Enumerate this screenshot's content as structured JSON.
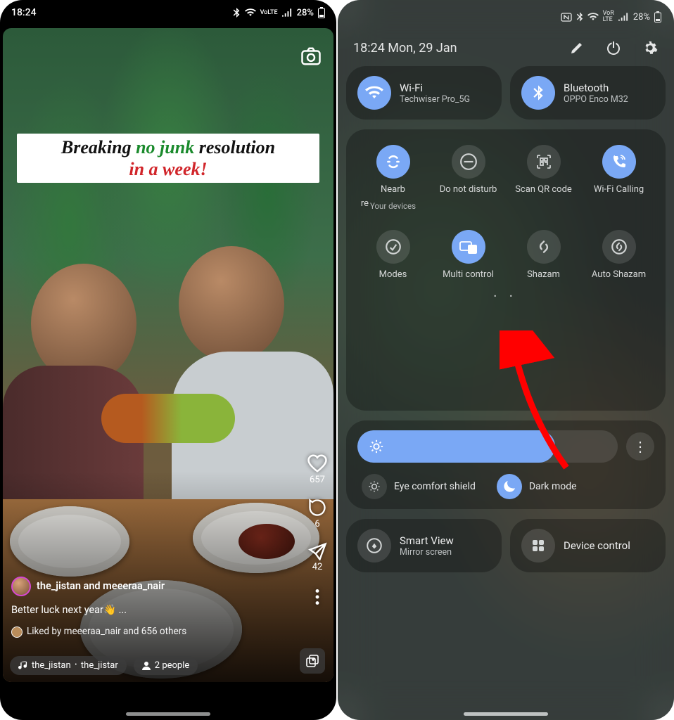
{
  "left_status": {
    "time": "18:24",
    "battery": "28%",
    "net": "VoLTE"
  },
  "story": {
    "banner_a": "Breaking ",
    "banner_b": "no junk",
    "banner_c": " resolution",
    "banner_d": "in a week!",
    "user_line": "the_jistan and meeeraa_nair",
    "caption": "Better luck next year👋 ...",
    "liked_by": "Liked by meeeraa_nair and 656 others",
    "music_chip": "the_jistan ᛫ the_jistar",
    "people_chip": "2 people",
    "likes": "657",
    "comments": "6",
    "shares": "42"
  },
  "right_status": {
    "battery": "28%"
  },
  "panel": {
    "datetime": "18:24  Mon, 29 Jan",
    "wifi": {
      "title": "Wi-Fi",
      "sub": "Techwiser Pro_5G"
    },
    "bt": {
      "title": "Bluetooth",
      "sub": "OPPO Enco M32"
    },
    "tiles": [
      {
        "id": "nearby",
        "label": "Nearb",
        "sub": "Your devices",
        "active": true
      },
      {
        "id": "dnd",
        "label": "Do not disturb",
        "sub": "",
        "active": false
      },
      {
        "id": "qr",
        "label": "Scan QR code",
        "sub": "",
        "active": false
      },
      {
        "id": "wificall",
        "label": "Wi-Fi Calling",
        "sub": "",
        "active": true
      },
      {
        "id": "modes",
        "label": "Modes",
        "sub": "",
        "active": false
      },
      {
        "id": "multi",
        "label": "Multi control",
        "sub": "",
        "active": true
      },
      {
        "id": "shazam",
        "label": "Shazam",
        "sub": "",
        "active": false
      },
      {
        "id": "autoshazam",
        "label": "Auto Shazam",
        "sub": "",
        "active": false
      }
    ],
    "eye": "Eye comfort shield",
    "dark": "Dark mode",
    "smartview": {
      "title": "Smart View",
      "sub": "Mirror screen"
    },
    "devicectl": "Device control",
    "partial_re": "re"
  }
}
